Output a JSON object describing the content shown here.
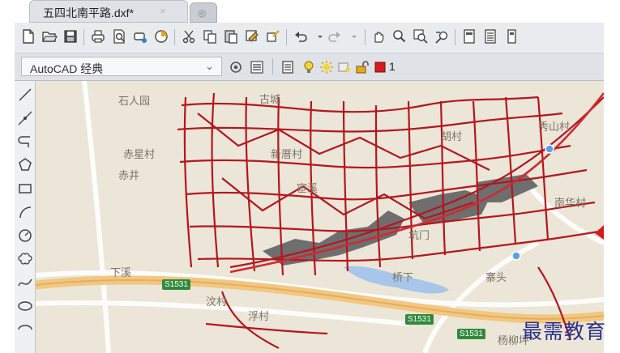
{
  "tab": {
    "title": "五四北南平路.dxf*",
    "close_glyph": "×",
    "new_glyph": "◎"
  },
  "toolbar": {
    "icons": [
      "new-icon",
      "open-icon",
      "save-icon",
      "print-icon",
      "print-preview-icon",
      "publish-icon",
      "plot-icon",
      "cut-icon",
      "copy-icon",
      "paste-icon",
      "match-properties-icon",
      "block-editor-icon",
      "undo-icon",
      "redo-icon",
      "pan-icon",
      "zoom-realtime-icon",
      "zoom-window-icon",
      "zoom-previous-icon",
      "properties-icon",
      "design-center-icon",
      "tool-palette-icon"
    ]
  },
  "workspace": {
    "label": "AutoCAD 经典",
    "arrow": "⌄"
  },
  "layer": {
    "current_color": "#d71920",
    "current_name": "1"
  },
  "drawbar": {
    "icons": [
      "line-icon",
      "construction-line-icon",
      "polyline-icon",
      "polygon-icon",
      "rectangle-icon",
      "arc-icon",
      "circle-icon",
      "revision-cloud-icon",
      "spline-icon",
      "ellipse-icon",
      "ellipse-arc-icon"
    ]
  },
  "map": {
    "labels": [
      {
        "text": "石人园"
      },
      {
        "text": "古城"
      },
      {
        "text": "赤星村"
      },
      {
        "text": "赤井"
      },
      {
        "text": "新厝村"
      },
      {
        "text": "宦溪"
      },
      {
        "text": "胡村"
      },
      {
        "text": "秀山村"
      },
      {
        "text": "下溪"
      },
      {
        "text": "浮村"
      },
      {
        "text": "汶村"
      },
      {
        "text": "桥下"
      },
      {
        "text": "寨头"
      },
      {
        "text": "坑门"
      },
      {
        "text": "南华村"
      },
      {
        "text": "杨柳坪"
      }
    ],
    "road_shields": [
      "S1531",
      "S1531",
      "S1531"
    ],
    "line_color": "#b4161e"
  },
  "watermark": "最需教育"
}
